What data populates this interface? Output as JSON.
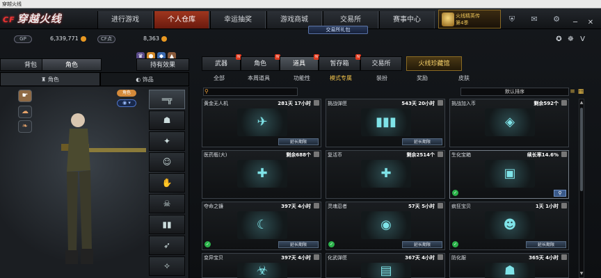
{
  "window": {
    "title": "穿越火线"
  },
  "logo": {
    "text": "穿越火线",
    "badge": "CF"
  },
  "nav": {
    "tabs": [
      {
        "label": "进行游戏"
      },
      {
        "label": "个人仓库"
      },
      {
        "label": "幸运抽奖"
      },
      {
        "label": "游戏商城"
      },
      {
        "label": "交易所"
      },
      {
        "label": "赛事中心"
      }
    ],
    "active": 1
  },
  "promo": {
    "line1": "火线精英传",
    "line2": "第4季"
  },
  "gift_banner": "交易所礼包",
  "currency": {
    "gp_label": "GP",
    "gp_value": "6,339,771",
    "cf_label": "CF点",
    "cf_value": "8,363"
  },
  "left": {
    "subtabs": [
      {
        "label": "背包"
      },
      {
        "label": "角色"
      },
      {
        "label": "持有效果"
      }
    ],
    "categories": [
      {
        "label": "角色"
      },
      {
        "label": "饰品"
      }
    ],
    "role_badge": "角色",
    "eye_badge": "◉ ▾"
  },
  "main_tabs": [
    {
      "label": "武器"
    },
    {
      "label": "角色"
    },
    {
      "label": "道具"
    },
    {
      "label": "暂存箱"
    },
    {
      "label": "交易所"
    }
  ],
  "vip_tab": "火线珍藏馆",
  "sub_tabs": [
    {
      "label": "全部"
    },
    {
      "label": "本周道具"
    },
    {
      "label": "功能性"
    },
    {
      "label": "模式专属"
    },
    {
      "label": "装扮"
    },
    {
      "label": "奖励"
    },
    {
      "label": "皮肤"
    }
  ],
  "sort": {
    "label": "默认排序"
  },
  "cards": [
    {
      "name": "黄金无人机",
      "time": "281天 17小时",
      "ext": "延长期限",
      "icon": "✈"
    },
    {
      "name": "挑战弹匣",
      "time": "543天 20小时",
      "ext": "延长期限",
      "icon": "▮▮▮"
    },
    {
      "name": "挑战加入币",
      "time": "剩余592个",
      "ext": "",
      "icon": "◈"
    },
    {
      "name": "医药瓶(大)",
      "time": "剩余688个",
      "ext": "",
      "icon": "✚"
    },
    {
      "name": "复活币",
      "time": "剩余2514个",
      "ext": "",
      "icon": "✚"
    },
    {
      "name": "生化宝箱",
      "time": "续长率14.6%",
      "ext": "",
      "icon": "▣"
    },
    {
      "name": "夺命之镰",
      "time": "397天 4小时",
      "ext": "延长期限",
      "icon": "☾"
    },
    {
      "name": "灵魂忍者",
      "time": "57天 5小时",
      "ext": "延长期限",
      "icon": "◉"
    },
    {
      "name": "疯狂宝贝",
      "time": "1天 1小时",
      "ext": "延长期限",
      "icon": "☻"
    },
    {
      "name": "变异宝贝",
      "time": "397天 4小时",
      "ext": "",
      "icon": "☣"
    },
    {
      "name": "化武弹匣",
      "time": "367天 4小时",
      "ext": "",
      "icon": "▤"
    },
    {
      "name": "防化服",
      "time": "365天 4小时",
      "ext": "",
      "icon": "☗"
    }
  ]
}
